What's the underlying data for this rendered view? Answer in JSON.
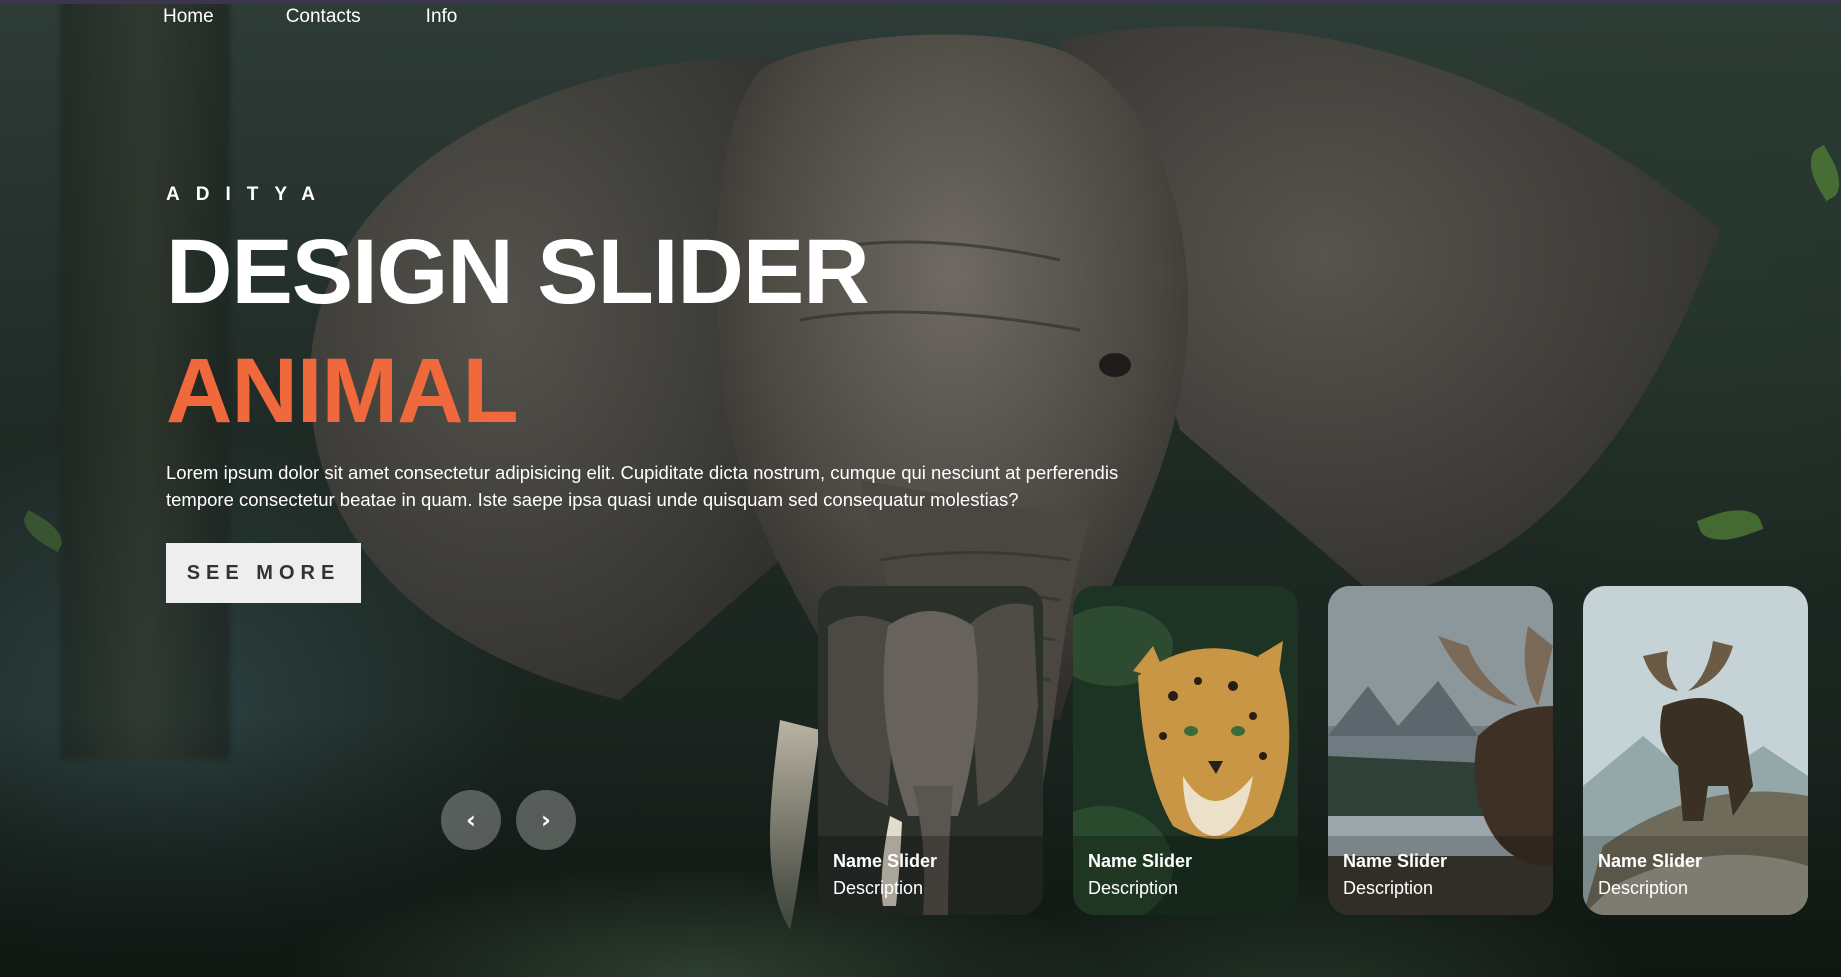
{
  "nav": {
    "items": [
      {
        "label": "Home"
      },
      {
        "label": "Contacts"
      },
      {
        "label": "Info"
      }
    ]
  },
  "hero": {
    "author": "ADITYA",
    "title": "DESIGN SLIDER",
    "topic": "ANIMAL",
    "description": "Lorem ipsum dolor sit amet consectetur adipisicing elit. Cupiditate dicta nostrum, cumque qui nesciunt at perferendis tempore consectetur beatae in quam. Iste saepe ipsa quasi unde quisquam sed consequatur molestias?",
    "button_label": "SEE MORE",
    "accent_color": "#f0693d"
  },
  "thumbnails": [
    {
      "name": "Name Slider",
      "description": "Description",
      "subject": "elephant"
    },
    {
      "name": "Name Slider",
      "description": "Description",
      "subject": "leopard"
    },
    {
      "name": "Name Slider",
      "description": "Description",
      "subject": "moose-lake"
    },
    {
      "name": "Name Slider",
      "description": "Description",
      "subject": "moose-hill"
    }
  ],
  "arrows": {
    "prev_icon": "chevron-left-icon",
    "next_icon": "chevron-right-icon",
    "prev_label": "‹",
    "next_label": "›"
  }
}
